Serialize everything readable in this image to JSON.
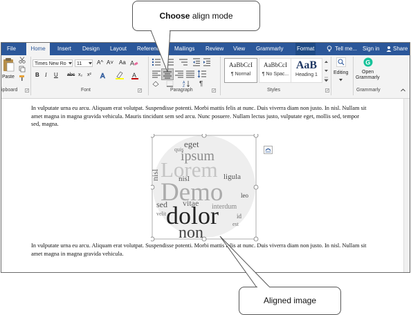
{
  "callouts": {
    "top_bold": "Choose",
    "top_rest": " align mode",
    "bottom": "Aligned image"
  },
  "tabs": [
    "File",
    "Home",
    "Insert",
    "Design",
    "Layout",
    "Reference",
    "Mailings",
    "Review",
    "View",
    "Grammarly",
    "Format"
  ],
  "tell_me": "Tell me...",
  "sign_in": "Sign in",
  "share": "Share",
  "clipboard": {
    "paste": "Paste",
    "group": "ipboard"
  },
  "font": {
    "name": "Times New Ro",
    "size": "11",
    "group": "Font",
    "bold": "B",
    "italic": "I",
    "underline": "U",
    "strike": "abc",
    "subscript": "x₂",
    "superscript": "x²",
    "grow": "A^",
    "shrink": "A˅",
    "case": "Aa",
    "clear": "A"
  },
  "paragraph": {
    "group": "Paragraph"
  },
  "styles": {
    "group": "Styles",
    "items": [
      {
        "preview": "AaBbCcI",
        "name": "¶ Normal"
      },
      {
        "preview": "AaBbCcI",
        "name": "¶ No Spac..."
      },
      {
        "preview": "AaB",
        "name": "Heading 1"
      }
    ]
  },
  "editing": {
    "label": "Editing"
  },
  "grammarly": {
    "label1": "Open",
    "label2": "Grammarly",
    "group": "Grammarly"
  },
  "document": {
    "para1": "In vulputate urna eu arcu. Aliquam erat volutpat. Suspendisse potenti. Morbi mattis felis at nunc. Duis viverra diam non justo. In nisl. Nullam sit amet magna in magna gravida vehicula. Mauris tincidunt sem sed arcu. Nunc posuere. Nullam lectus justo, vulputate eget, mollis sed, tempor sed, magna.",
    "para2": "In vulputate urna eu arcu. Aliquam erat volutpat. Suspendisse potenti. Morbi mattis felis at nunc. Duis viverra diam non justo. In nisl. Nullam sit amet magna in magna gravida vehicula."
  },
  "wordcloud": {
    "words": [
      "eget",
      "ipsum",
      "quis",
      "Lorem",
      "nisl",
      "Demo",
      "ligula",
      "sed",
      "vitae",
      "interdum",
      "leo",
      "dolor",
      "non",
      "id",
      "est",
      "velit"
    ]
  },
  "colors": {
    "title_bar": "#2b579a",
    "ribbon_bg": "#f3f3f3",
    "accent": "#2b579a",
    "highlight": "#ffff00",
    "font_color": "#c00000",
    "grammarly": "#15c39a"
  }
}
